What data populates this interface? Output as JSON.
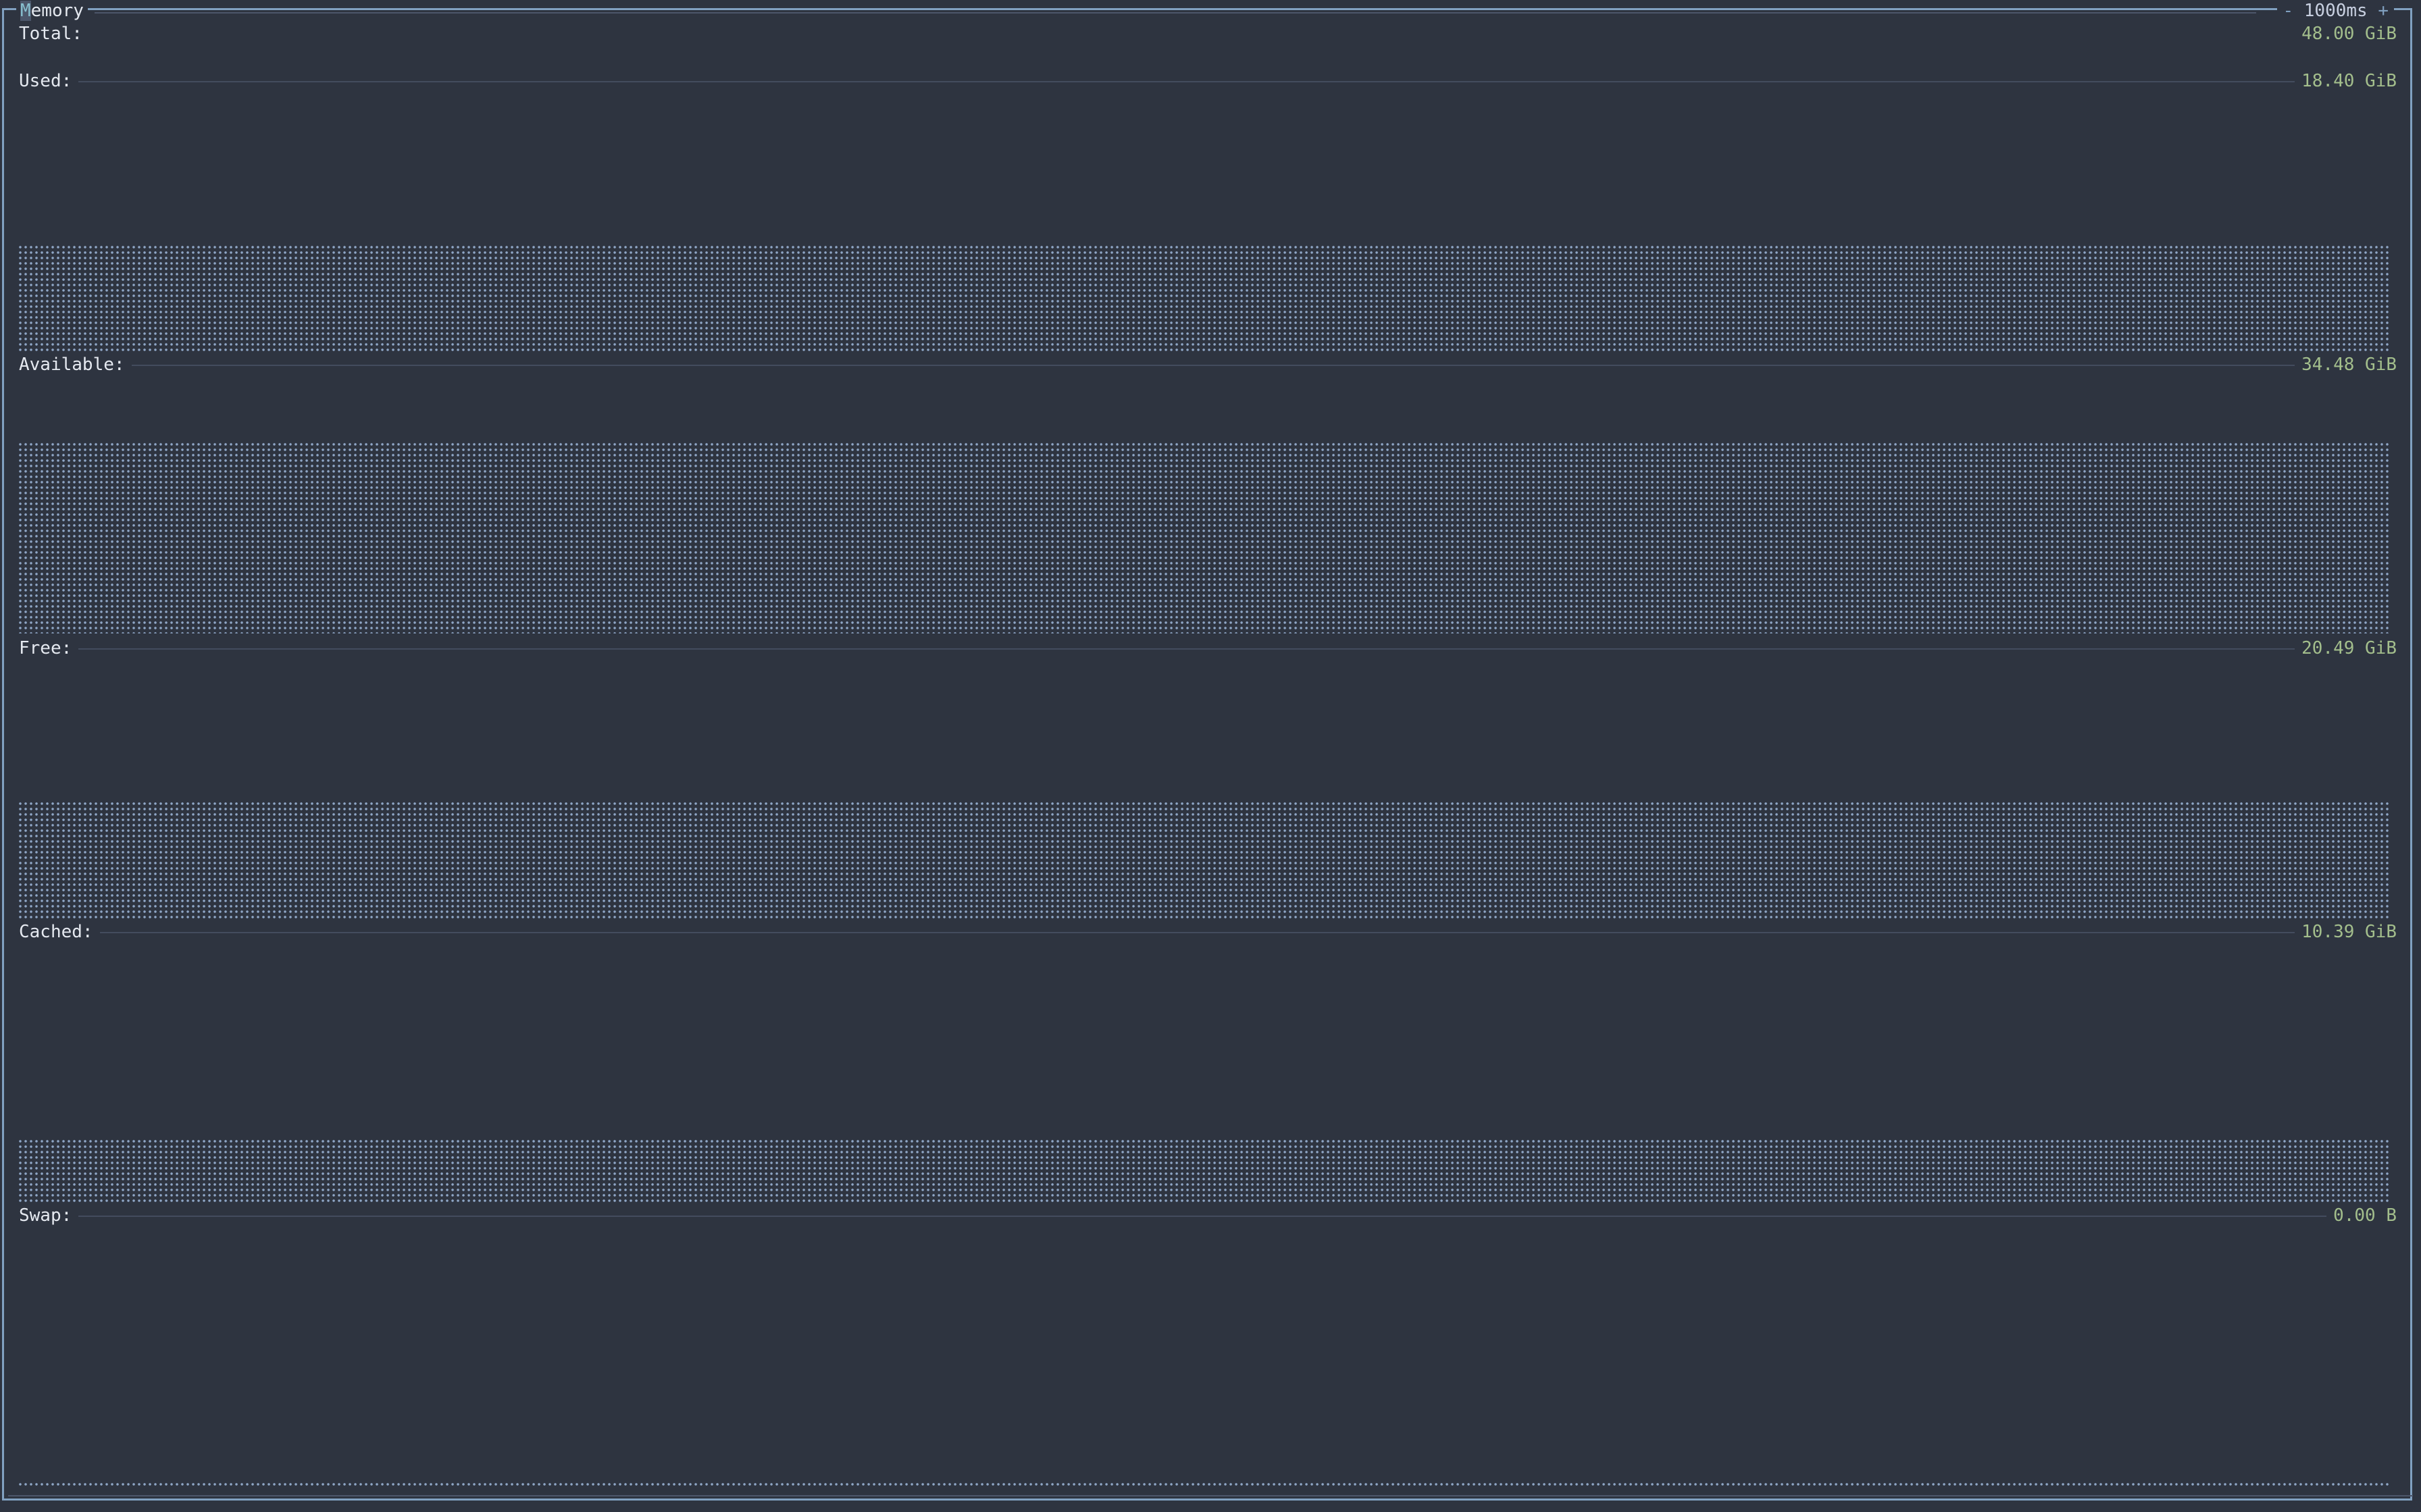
{
  "panel": {
    "title_hot": "M",
    "title_rest": "emory",
    "interval": {
      "minus": "-",
      "value": "1000ms",
      "plus": "+"
    }
  },
  "rows": [
    {
      "key": "total",
      "label": "Total:",
      "value": "48.00 GiB"
    },
    {
      "key": "used",
      "label": "Used:",
      "value": "18.40 GiB",
      "level": 0.38
    },
    {
      "key": "available",
      "label": "Available:",
      "value": "34.48 GiB",
      "level": 0.72
    },
    {
      "key": "free",
      "label": "Free:",
      "value": "20.49 GiB",
      "level": 0.43
    },
    {
      "key": "cached",
      "label": "Cached:",
      "value": "10.39 GiB",
      "level": 0.22
    },
    {
      "key": "swap",
      "label": "Swap:",
      "value": "0.00 B",
      "level": 0.0
    }
  ],
  "colors": {
    "background": "#2e3440",
    "border": "#81a1c1",
    "graph_dots": "#8fa6c6",
    "value_text": "#a3be8c",
    "label_text": "#e5e9f0"
  }
}
